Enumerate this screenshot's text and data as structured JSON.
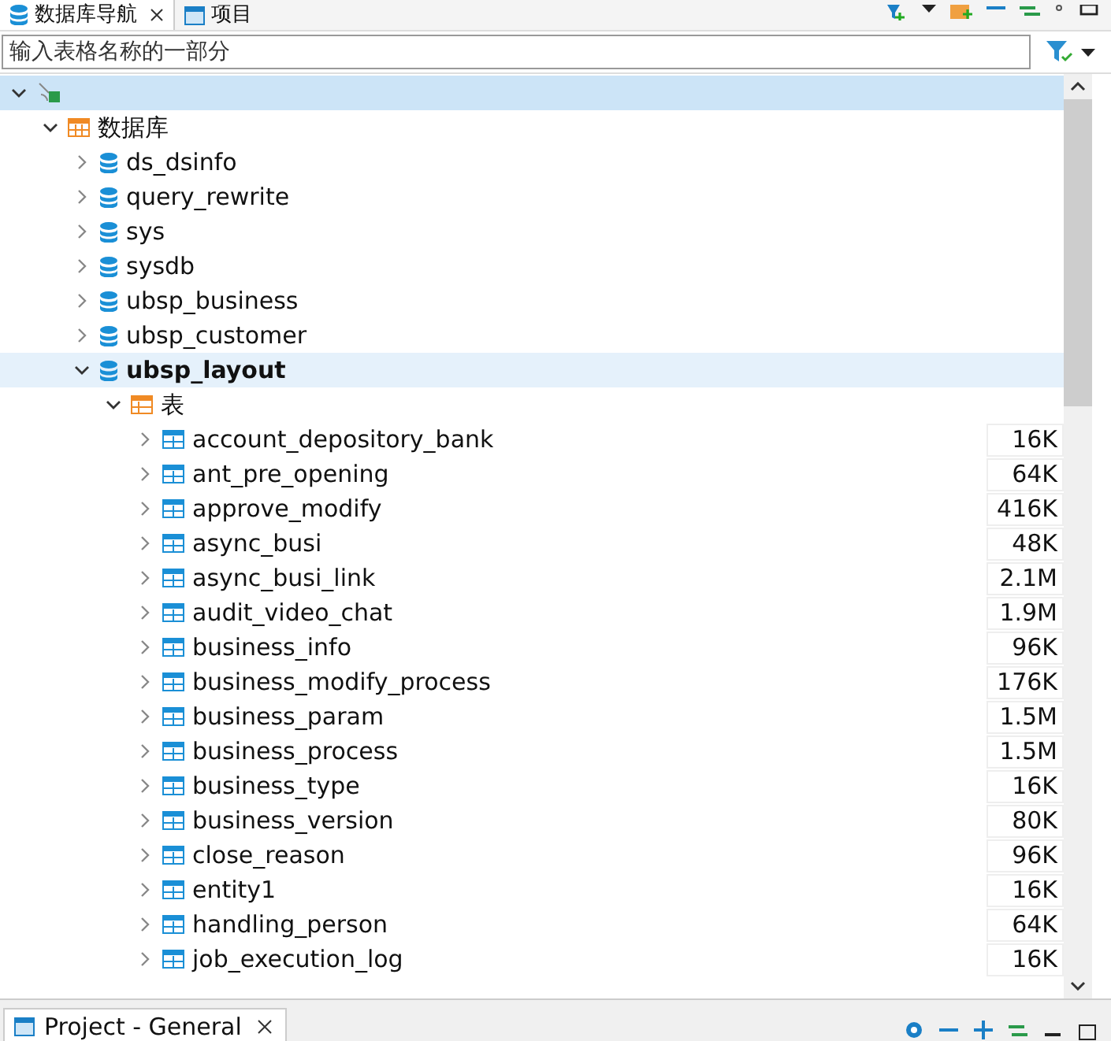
{
  "tabs": [
    {
      "label": "数据库导航",
      "selected": true,
      "closable": true,
      "kind": "db"
    },
    {
      "label": "项目",
      "selected": false,
      "closable": false,
      "kind": "project"
    }
  ],
  "search": {
    "placeholder": "输入表格名称的一部分"
  },
  "tree": [
    {
      "kind": "connection",
      "expanded": true,
      "selected": true,
      "children": [
        {
          "kind": "folder",
          "label": "数据库",
          "expanded": true,
          "selected": false,
          "children": [
            {
              "kind": "database",
              "label": "ds_dsinfo",
              "expanded": false,
              "selected": false
            },
            {
              "kind": "database",
              "label": "query_rewrite",
              "expanded": false,
              "selected": false
            },
            {
              "kind": "database",
              "label": "sys",
              "expanded": false,
              "selected": false
            },
            {
              "kind": "database",
              "label": "sysdb",
              "expanded": false,
              "selected": false
            },
            {
              "kind": "database",
              "label": "ubsp_business",
              "expanded": false,
              "selected": false
            },
            {
              "kind": "database",
              "label": "ubsp_customer",
              "expanded": false,
              "selected": false
            },
            {
              "kind": "database",
              "label": "ubsp_layout",
              "expanded": true,
              "selected": true,
              "bold": true,
              "children": [
                {
                  "kind": "tables",
                  "label": "表",
                  "expanded": true,
                  "selected": false,
                  "children": [
                    {
                      "kind": "table",
                      "label": "account_depository_bank",
                      "size": "16K",
                      "expanded": false,
                      "selected": false
                    },
                    {
                      "kind": "table",
                      "label": "ant_pre_opening",
                      "size": "64K",
                      "expanded": false,
                      "selected": false
                    },
                    {
                      "kind": "table",
                      "label": "approve_modify",
                      "size": "416K",
                      "expanded": false,
                      "selected": false
                    },
                    {
                      "kind": "table",
                      "label": "async_busi",
                      "size": "48K",
                      "expanded": false,
                      "selected": false
                    },
                    {
                      "kind": "table",
                      "label": "async_busi_link",
                      "size": "2.1M",
                      "expanded": false,
                      "selected": false
                    },
                    {
                      "kind": "table",
                      "label": "audit_video_chat",
                      "size": "1.9M",
                      "expanded": false,
                      "selected": false
                    },
                    {
                      "kind": "table",
                      "label": "business_info",
                      "size": "96K",
                      "expanded": false,
                      "selected": false
                    },
                    {
                      "kind": "table",
                      "label": "business_modify_process",
                      "size": "176K",
                      "expanded": false,
                      "selected": false
                    },
                    {
                      "kind": "table",
                      "label": "business_param",
                      "size": "1.5M",
                      "expanded": false,
                      "selected": false
                    },
                    {
                      "kind": "table",
                      "label": "business_process",
                      "size": "1.5M",
                      "expanded": false,
                      "selected": false
                    },
                    {
                      "kind": "table",
                      "label": "business_type",
                      "size": "16K",
                      "expanded": false,
                      "selected": false
                    },
                    {
                      "kind": "table",
                      "label": "business_version",
                      "size": "80K",
                      "expanded": false,
                      "selected": false
                    },
                    {
                      "kind": "table",
                      "label": "close_reason",
                      "size": "96K",
                      "expanded": false,
                      "selected": false
                    },
                    {
                      "kind": "table",
                      "label": "entity1",
                      "size": "16K",
                      "expanded": false,
                      "selected": false
                    },
                    {
                      "kind": "table",
                      "label": "handling_person",
                      "size": "64K",
                      "expanded": false,
                      "selected": false
                    },
                    {
                      "kind": "table",
                      "label": "job_execution_log",
                      "size": "16K",
                      "expanded": false,
                      "selected": false
                    }
                  ]
                }
              ]
            }
          ]
        }
      ]
    }
  ],
  "bottom_panel": {
    "tab": {
      "label": "Project - General",
      "closable": true
    }
  }
}
